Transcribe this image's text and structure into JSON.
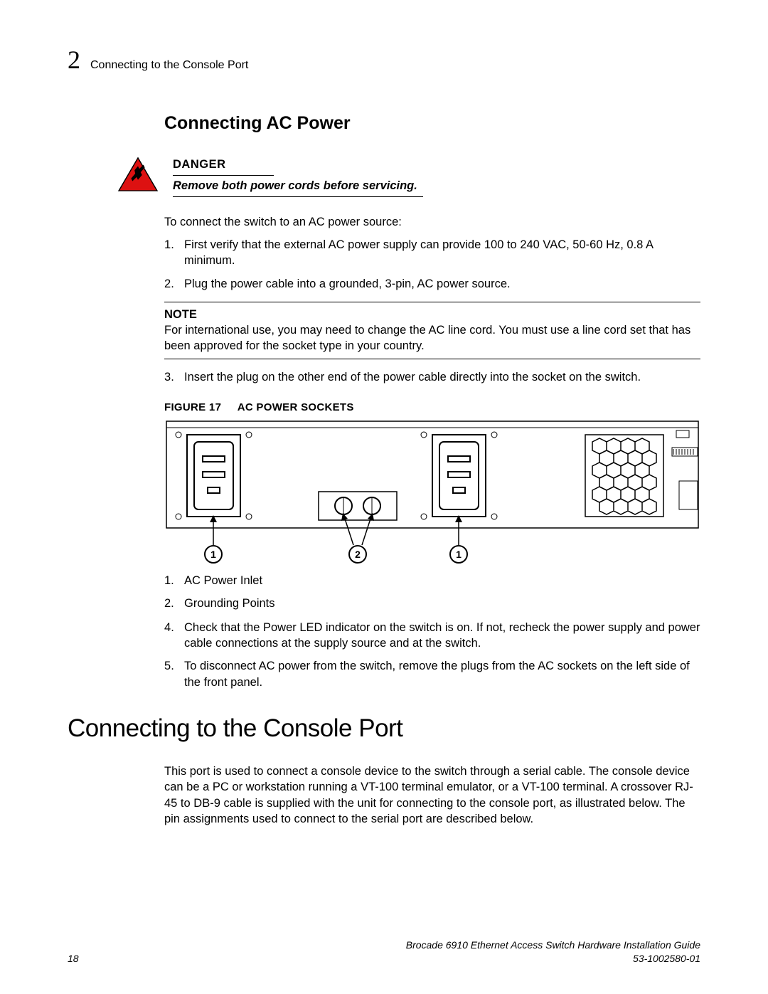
{
  "header": {
    "chapter_number": "2",
    "running_title": "Connecting to the Console Port"
  },
  "section_ac": {
    "heading": "Connecting AC Power",
    "danger": {
      "label": "DANGER",
      "text": "Remove both power cords before servicing."
    },
    "intro": "To connect the switch to an AC power source:",
    "step1": "First verify that the external AC power supply can provide 100 to 240 VAC, 50-60 Hz, 0.8 A minimum.",
    "step2": "Plug the power cable into a grounded, 3-pin, AC power source.",
    "note": {
      "label": "NOTE",
      "text": "For international use, you may need to change the AC line cord. You must use a line cord set that has been approved for the socket type in your country."
    },
    "step3": "Insert the plug on the other end of the power cable directly into the socket on the switch.",
    "figure": {
      "label": "FIGURE 17",
      "title": "AC POWER SOCKETS",
      "callouts": {
        "c1": "1",
        "c2": "2",
        "c3": "1"
      }
    },
    "legend": {
      "l1_num": "1.",
      "l1_text": "AC Power Inlet",
      "l2_num": "2.",
      "l2_text": "Grounding Points"
    },
    "step4": "Check that the Power LED indicator on the switch is on. If not, recheck the power supply and power cable connections at the supply source and at the switch.",
    "step5": "To disconnect AC power from the switch, remove the plugs from the AC sockets on the left side of the front panel."
  },
  "section_console": {
    "heading": "Connecting to the Console Port",
    "para": "This port is used to connect a console device to the switch through a serial cable. The console device can be a PC or workstation running a VT-100 terminal emulator, or a VT-100 terminal. A crossover RJ-45 to DB-9 cable is supplied with the unit for connecting to the console port, as illustrated below. The pin assignments used to connect to the serial port are described below."
  },
  "footer": {
    "page": "18",
    "doc_title": "Brocade 6910 Ethernet Access Switch Hardware Installation Guide",
    "doc_number": "53-1002580-01"
  }
}
